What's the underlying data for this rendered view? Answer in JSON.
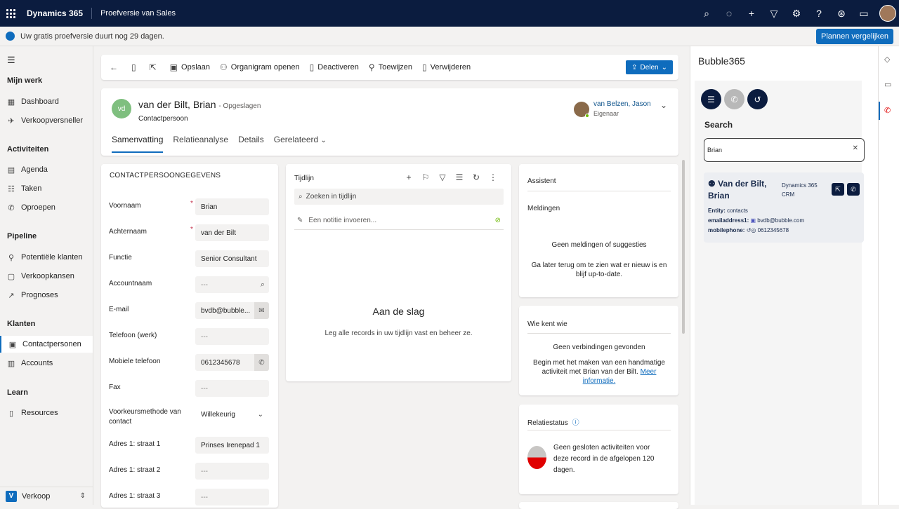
{
  "topbar": {
    "brand": "Dynamics 365",
    "app_name": "Proefversie van Sales",
    "icons": [
      "search-icon",
      "lightbulb-icon",
      "plus-icon",
      "filter-icon",
      "gear-icon",
      "help-icon",
      "copilot-icon",
      "chat-icon"
    ]
  },
  "trial": {
    "text": "Uw gratis proefversie duurt nog 29 dagen.",
    "button": "Plannen vergelijken"
  },
  "sidebar": {
    "sections": [
      {
        "title": "Mijn werk",
        "items": [
          {
            "label": "Dashboard",
            "icon": "dashboard-icon"
          },
          {
            "label": "Verkoopversneller",
            "icon": "rocket-icon"
          }
        ]
      },
      {
        "title": "Activiteiten",
        "items": [
          {
            "label": "Agenda",
            "icon": "calendar-icon"
          },
          {
            "label": "Taken",
            "icon": "tasks-icon"
          },
          {
            "label": "Oproepen",
            "icon": "phone-icon"
          }
        ]
      },
      {
        "title": "Pipeline",
        "items": [
          {
            "label": "Potentiële klanten",
            "icon": "lead-icon"
          },
          {
            "label": "Verkoopkansen",
            "icon": "opportunity-icon"
          },
          {
            "label": "Prognoses",
            "icon": "forecast-icon"
          }
        ]
      },
      {
        "title": "Klanten",
        "items": [
          {
            "label": "Contactpersonen",
            "icon": "contact-icon"
          },
          {
            "label": "Accounts",
            "icon": "accounts-icon"
          }
        ]
      },
      {
        "title": "Learn",
        "items": [
          {
            "label": "Resources",
            "icon": "book-icon"
          }
        ]
      }
    ],
    "footer": {
      "badge": "V",
      "label": "Verkoop"
    }
  },
  "commandbar": {
    "items": [
      "Opslaan",
      "Organigram openen",
      "Deactiveren",
      "Toewijzen",
      "Verwijderen"
    ],
    "share": "Delen"
  },
  "record": {
    "initials": "vd",
    "name": "van der Bilt, Brian",
    "saved": "- Opgeslagen",
    "type": "Contactpersoon",
    "owner_name": "van Belzen, Jason",
    "owner_role": "Eigenaar",
    "tabs": [
      "Samenvatting",
      "Relatieanalyse",
      "Details",
      "Gerelateerd"
    ]
  },
  "form": {
    "title": "CONTACTPERSOONGEGEVENS",
    "fields": [
      {
        "label": "Voornaam",
        "value": "Brian",
        "required": true
      },
      {
        "label": "Achternaam",
        "value": "van der Bilt",
        "required": true
      },
      {
        "label": "Functie",
        "value": "Senior Consultant"
      },
      {
        "label": "Accountnaam",
        "value": "---"
      },
      {
        "label": "E-mail",
        "value": "bvdb@bubble..."
      },
      {
        "label": "Telefoon (werk)",
        "value": "---"
      },
      {
        "label": "Mobiele telefoon",
        "value": "0612345678"
      },
      {
        "label": "Fax",
        "value": "---"
      },
      {
        "label": "Voorkeursmethode van contact",
        "value": "Willekeurig"
      },
      {
        "label": "Adres 1: straat 1",
        "value": "Prinses Irenepad 1"
      },
      {
        "label": "Adres 1: straat 2",
        "value": "---"
      },
      {
        "label": "Adres 1: straat 3",
        "value": "---"
      }
    ]
  },
  "timeline": {
    "title": "Tijdlijn",
    "search_placeholder": "Zoeken in tijdlijn",
    "note_placeholder": "Een notitie invoeren...",
    "empty_title": "Aan de slag",
    "empty_desc": "Leg alle records in uw tijdlijn vast en beheer ze."
  },
  "assistant": {
    "title": "Assistent",
    "subtitle": "Meldingen",
    "empty_title": "Geen meldingen of suggesties",
    "empty_desc": "Ga later terug om te zien wat er nieuw is en blijf up-to-date."
  },
  "whoknows": {
    "title": "Wie kent wie",
    "empty_title": "Geen verbindingen gevonden",
    "empty_desc": "Begin met het maken van een handmatige activiteit met Brian van der Bilt.",
    "link": "Meer informatie."
  },
  "relation": {
    "title": "Relatiestatus",
    "desc": "Geen gesloten activiteiten voor deze record in de afgelopen 120 dagen."
  },
  "bubble": {
    "title": "Bubble365",
    "search_label": "Search",
    "search_value": "Brian",
    "result": {
      "name": "Van der Bilt, Brian",
      "source": "Dynamics 365 CRM",
      "entity_label": "Entity:",
      "entity_value": "contacts",
      "email_label": "emailaddress1:",
      "email_value": "bvdb@bubble.com",
      "phone_label": "mobilephone:",
      "phone_value": "0612345678"
    }
  },
  "colors": {
    "topbar": "#0b1c3f",
    "accent": "#0f6cbd",
    "bubble_dark": "#0b1c3f",
    "relation_red": "#e00000"
  }
}
